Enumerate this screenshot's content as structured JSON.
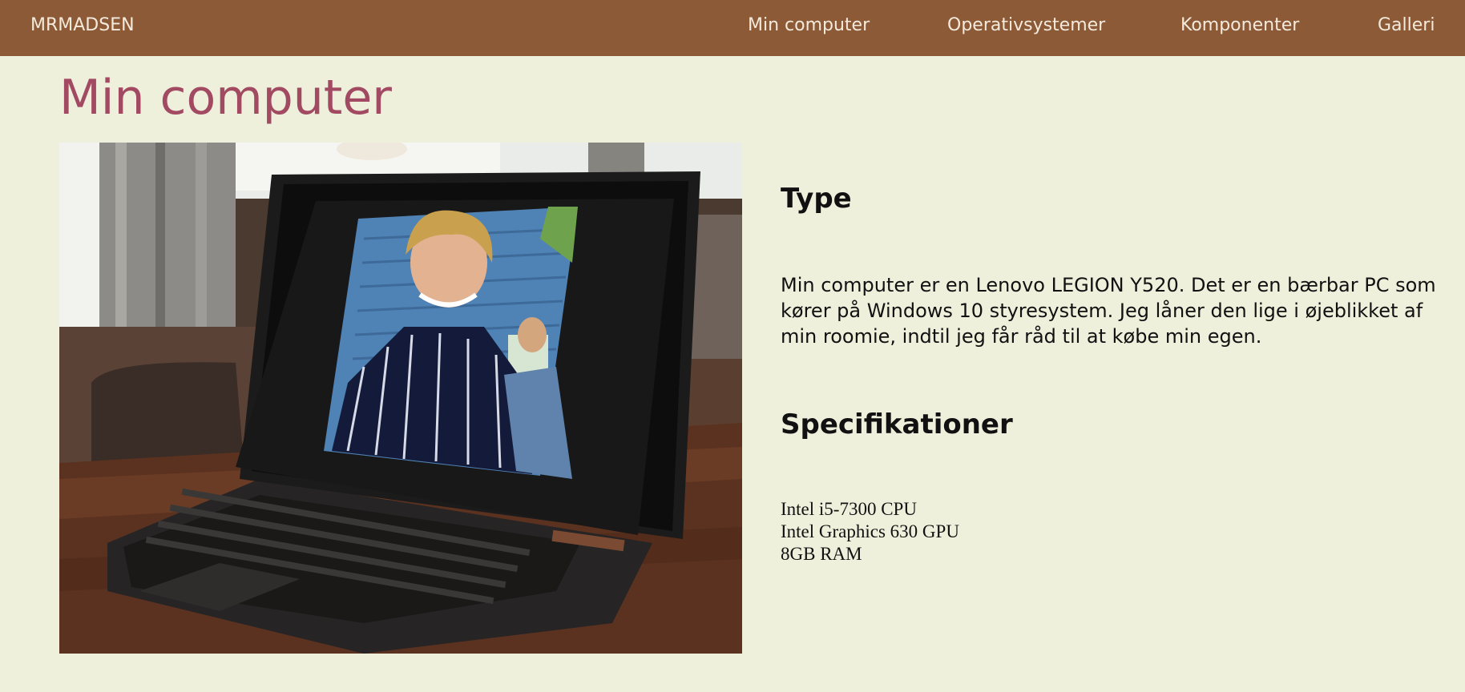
{
  "nav": {
    "brand": "MRMADSEN",
    "links": [
      "Min computer",
      "Operativsystemer",
      "Komponenter",
      "Galleri"
    ]
  },
  "main": {
    "title": "Min computer",
    "type": {
      "heading": "Type",
      "text": "Min computer er en Lenovo LEGION Y520. Det er en bærbar PC som kører på Windows 10 styresystem. Jeg låner den lige i øjeblikket af min roomie, indtil jeg får råd til at købe min egen."
    },
    "specs": {
      "heading": "Specifikationer",
      "items": [
        "Intel i5-7300 CPU",
        "Intel Graphics 630 GPU",
        "8GB RAM"
      ]
    }
  },
  "colors": {
    "navbar": "#8c5a37",
    "background": "#eef0dc",
    "title": "#a24a62"
  }
}
